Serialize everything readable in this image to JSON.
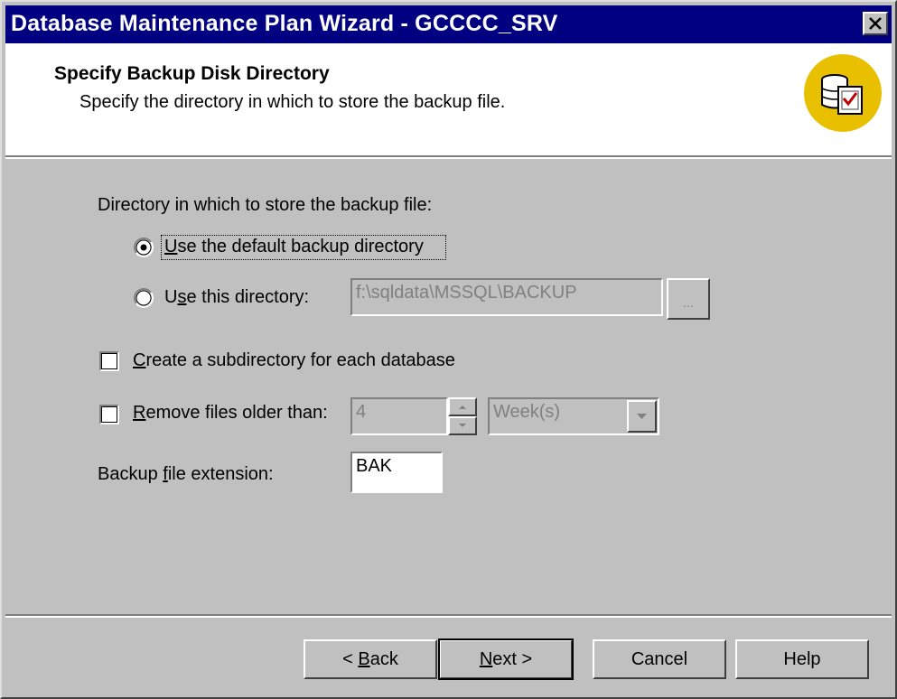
{
  "window": {
    "title": "Database Maintenance Plan Wizard - GCCCC_SRV",
    "close_glyph": "✕"
  },
  "header": {
    "title": "Specify Backup Disk Directory",
    "subtitle": "Specify the directory in which to store the backup file.",
    "icon": "database-checklist-icon"
  },
  "directory": {
    "label": "Directory in which to store the backup file:",
    "default_option": {
      "pre": "",
      "mnemonic": "U",
      "post": "se the default backup directory",
      "selected": true
    },
    "custom_option": {
      "pre": "U",
      "mnemonic": "s",
      "post": "e this directory:",
      "selected": false
    },
    "path_value": "f:\\sqldata\\MSSQL\\BACKUP",
    "browse_label": "..."
  },
  "subdirectory": {
    "pre": "",
    "mnemonic": "C",
    "post": "reate a subdirectory for each database",
    "checked": false
  },
  "remove_files": {
    "pre": "",
    "mnemonic": "R",
    "post": "emove files older than:",
    "checked": false,
    "amount": "4",
    "unit": "Week(s)"
  },
  "extension": {
    "pre": "Backup ",
    "mnemonic": "f",
    "post": "ile extension:",
    "value": "BAK"
  },
  "buttons": {
    "back": {
      "pre": "< ",
      "mnemonic": "B",
      "post": "ack"
    },
    "next": {
      "pre": "",
      "mnemonic": "N",
      "post": "ext >"
    },
    "cancel": "Cancel",
    "help": "Help"
  },
  "colors": {
    "title_bar": "#000080",
    "face": "#c0c0c0",
    "icon_gold": "#e8c000"
  }
}
